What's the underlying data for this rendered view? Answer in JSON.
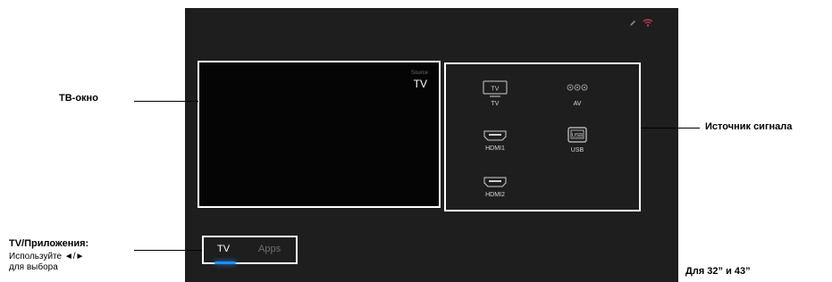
{
  "tv_window": {
    "source_caption": "Source",
    "source_value": "TV"
  },
  "sources": [
    {
      "id": "tv",
      "label": "TV",
      "icon_text": "TV",
      "icon": "tv-icon"
    },
    {
      "id": "av",
      "label": "AV",
      "icon": "av-jacks-icon"
    },
    {
      "id": "hdmi1",
      "label": "HDMI1",
      "icon": "hdmi-icon"
    },
    {
      "id": "usb",
      "label": "USB",
      "icon_text": "USB",
      "icon": "usb-icon"
    },
    {
      "id": "hdmi2",
      "label": "HDMI2",
      "icon": "hdmi-icon"
    }
  ],
  "tabs": {
    "tv": "TV",
    "apps": "Apps"
  },
  "status_icons": [
    "pencil-icon",
    "network-icon"
  ],
  "callouts": {
    "tv_window": "ТВ-окно",
    "source": "Источник сигнала",
    "tabs_title": "TV/Приложения:",
    "tabs_help_line1": "Используйте ◄/►",
    "tabs_help_line2": "для выбора"
  },
  "model_note": "Для 32” и 43”",
  "colors": {
    "screen_bg": "#1e1e1e",
    "accent": "#1e90ff",
    "frame": "#ffffff"
  }
}
